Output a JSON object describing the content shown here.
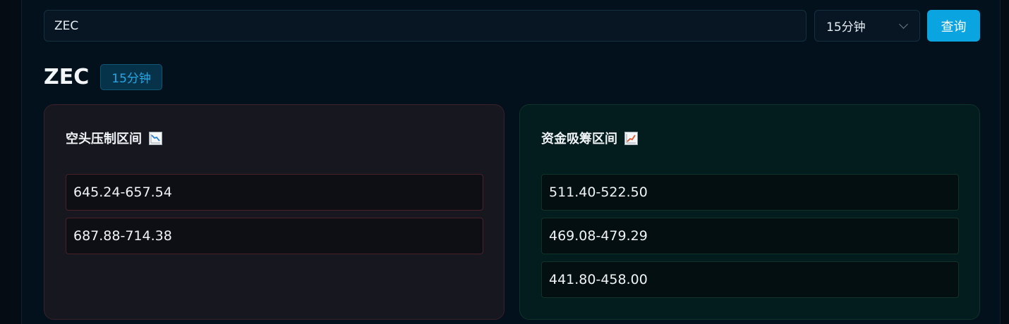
{
  "search": {
    "symbol_value": "ZEC",
    "interval_value": "15分钟",
    "query_label": "查询"
  },
  "header": {
    "symbol": "ZEC",
    "interval_badge": "15分钟"
  },
  "resistance": {
    "title": "空头压制区间",
    "icon": "chart-decreasing-icon",
    "ranges": [
      "645.24-657.54",
      "687.88-714.38"
    ]
  },
  "support": {
    "title": "资金吸筹区间",
    "icon": "chart-increasing-icon",
    "ranges": [
      "511.40-522.50",
      "469.08-479.29",
      "441.80-458.00"
    ]
  },
  "colors": {
    "accent": "#0aa4e0",
    "badge_text": "#24a8e6",
    "resist_border": "#4a2128",
    "support_border": "#123229"
  }
}
